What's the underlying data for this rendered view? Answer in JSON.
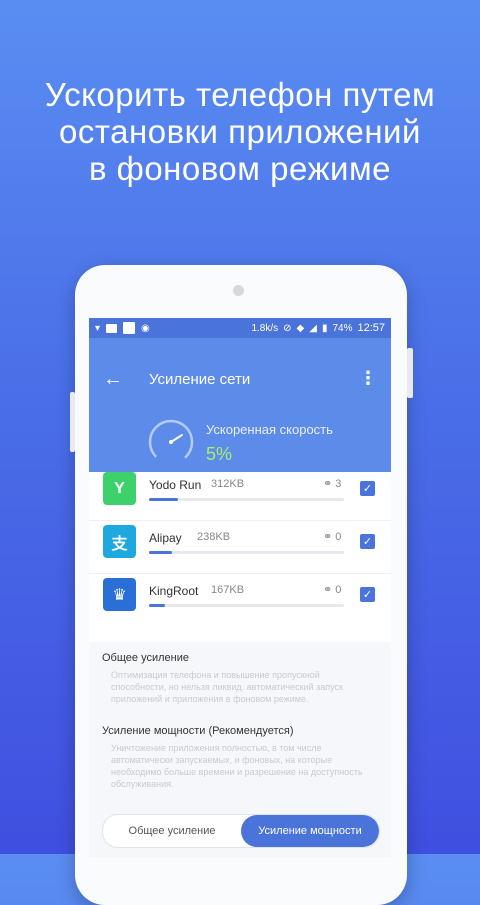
{
  "headline": {
    "line1": "Ускорить телефон путем",
    "line2": "остановки приложений",
    "line3": "в фоновом режиме"
  },
  "status_bar": {
    "speed": "1.8k/s",
    "battery": "74%",
    "time": "12:57"
  },
  "screen": {
    "title": "Усиление сети",
    "speed_label": "Ускоренная скорость",
    "speed_value": "5%"
  },
  "apps": [
    {
      "name": "Yodo Run",
      "size": "312KB",
      "links": "3",
      "progress": 0.15,
      "icon": "yodo-run-icon",
      "icon_color": "#3dd16b",
      "checked": true
    },
    {
      "name": "Alipay",
      "size": "238KB",
      "links": "0",
      "progress": 0.12,
      "icon": "alipay-icon",
      "icon_color": "#1fa8e0",
      "checked": true
    },
    {
      "name": "KingRoot",
      "size": "167KB",
      "links": "0",
      "progress": 0.08,
      "icon": "kingroot-icon",
      "icon_color": "#2a6fd6",
      "checked": true
    }
  ],
  "info": {
    "general_title": "Общее усиление",
    "general_desc": "Оптимизация телефона и повышение пропускной способности, но нельзя ликвид. автоматический запуск приложений и приложения в фоновом режиме.",
    "power_title": "Усиление мощности (Рекомендуется)",
    "power_desc": "Уничтожение приложения полностью, в том числе автоматически запускаемых, и фоновых, на которые необходимо больше времени и разрешение на доступность обслуживания."
  },
  "toggle": {
    "option_general": "Общее усиление",
    "option_power": "Усиление мощности"
  },
  "colors": {
    "accent": "#4a74d9",
    "header": "#5d8bea",
    "speed_value": "#a7f06a"
  }
}
